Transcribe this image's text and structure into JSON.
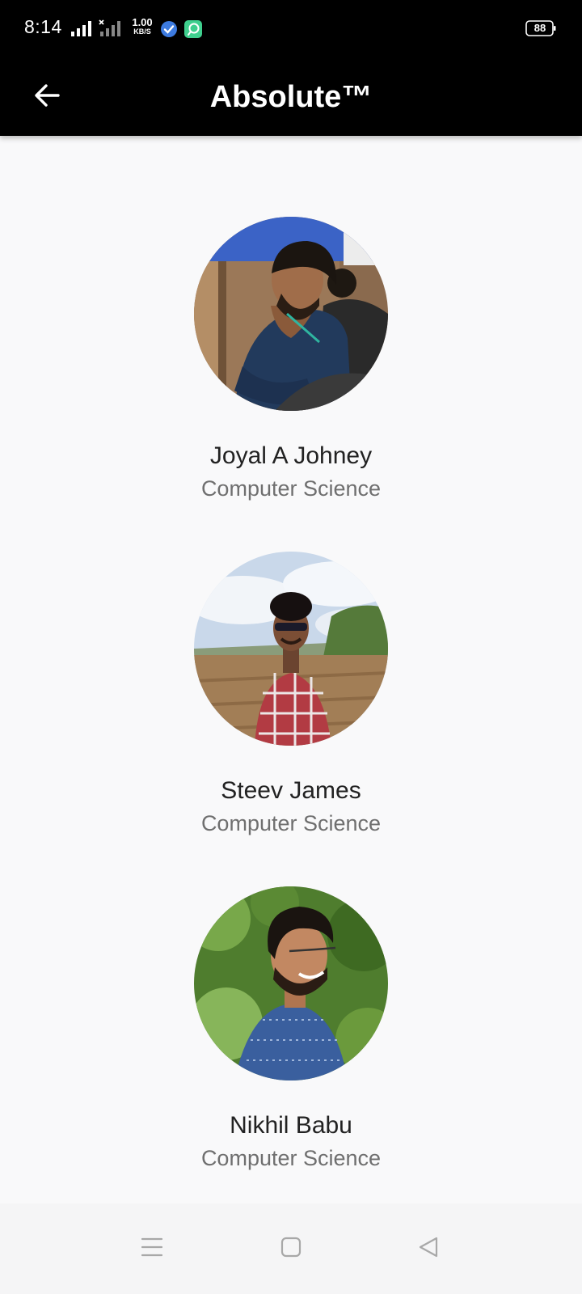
{
  "status_bar": {
    "time": "8:14",
    "net_speed_value": "1.00",
    "net_speed_unit": "KB/S",
    "battery_level": "88",
    "icons": [
      "signal-bars-icon",
      "signal-bars-no-service-icon",
      "tick-notification-icon",
      "chat-notification-icon",
      "battery-icon"
    ]
  },
  "app_bar": {
    "title": "Absolute™",
    "back_icon": "arrow-left-icon"
  },
  "members": [
    {
      "name": "Joyal A Johney",
      "department": "Computer Science"
    },
    {
      "name": "Steev James",
      "department": "Computer Science"
    },
    {
      "name": "Nikhil Babu",
      "department": "Computer Science"
    }
  ],
  "nav_bar": {
    "icons": [
      "menu-lines-icon",
      "home-square-icon",
      "back-triangle-icon"
    ]
  },
  "colors": {
    "app_bar_background": "#000000",
    "page_background": "#f9f9fa",
    "name_text": "#222222",
    "department_text": "#6f6f6f"
  }
}
